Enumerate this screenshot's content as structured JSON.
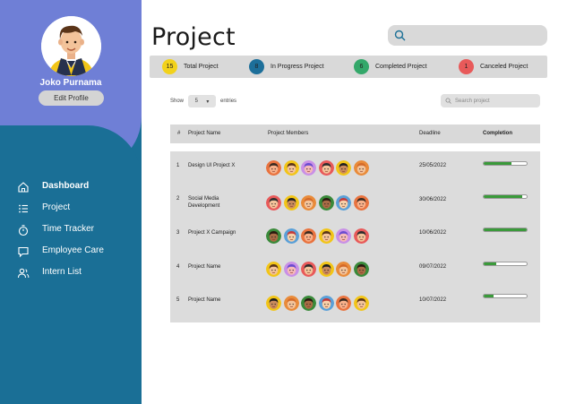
{
  "user": {
    "name": "Joko Purnama",
    "edit_label": "Edit Profile"
  },
  "nav": [
    {
      "label": "Dashboard",
      "icon": "home-icon",
      "active": true
    },
    {
      "label": "Project",
      "icon": "list-icon",
      "active": false
    },
    {
      "label": "Time Tracker",
      "icon": "stopwatch-icon",
      "active": false
    },
    {
      "label": "Employee Care",
      "icon": "chat-icon",
      "active": false
    },
    {
      "label": "Intern List",
      "icon": "users-icon",
      "active": false
    }
  ],
  "page": {
    "title": "Project"
  },
  "stats": [
    {
      "count": "15",
      "label": "Total Project",
      "color": "#f2d21b"
    },
    {
      "count": "8",
      "label": "In Progress Project",
      "color": "#1d6f9a"
    },
    {
      "count": "6",
      "label": "Completed Project",
      "color": "#34a86a"
    },
    {
      "count": "1",
      "label": "Canceled Project",
      "color": "#e85a5a"
    }
  ],
  "table_controls": {
    "show_label": "Show",
    "entries_value": "5",
    "entries_label": "entries",
    "search_placeholder": "Search project"
  },
  "table": {
    "columns": [
      "#",
      "Project Name",
      "Project Members",
      "Deadline",
      "Completion"
    ],
    "rows": [
      {
        "num": "1",
        "name": "Design UI Project X",
        "deadline": "25/05/2022",
        "completion": 0.65
      },
      {
        "num": "2",
        "name": "Social Media Development",
        "deadline": "30/06/2022",
        "completion": 0.9
      },
      {
        "num": "3",
        "name": "Project X Campaign",
        "deadline": "10/06/2022",
        "completion": 1.0
      },
      {
        "num": "4",
        "name": "Project Name",
        "deadline": "09/07/2022",
        "completion": 0.3
      },
      {
        "num": "5",
        "name": "Project Name",
        "deadline": "10/07/2022",
        "completion": 0.22
      }
    ]
  },
  "colors": {
    "sidebar": "#1a6f96",
    "sidebar_top": "#6f7fd6",
    "progress": "#3a9a3a"
  }
}
